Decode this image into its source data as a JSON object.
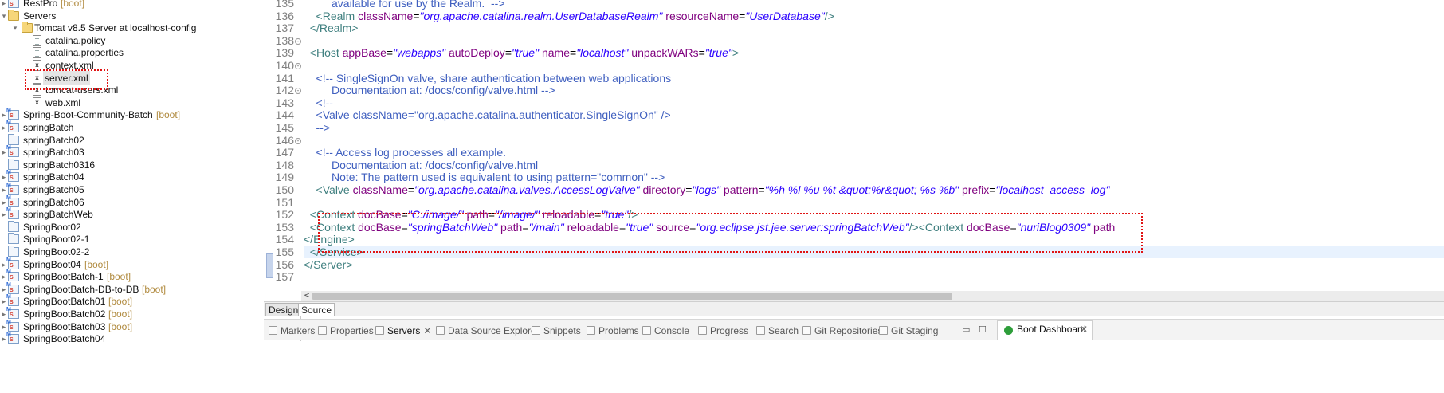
{
  "explorer": {
    "rows": [
      {
        "label": "RestPro",
        "tag": "[boot]",
        "icon": "spring-project-icon",
        "twisty": "▸"
      },
      {
        "label": "Servers",
        "tag": "",
        "icon": "folder-icon",
        "twisty": "▾"
      },
      {
        "label": "Tomcat v8.5 Server at localhost-config",
        "tag": "",
        "icon": "folder-icon",
        "twisty": "▾"
      },
      {
        "label": "catalina.policy",
        "tag": "",
        "icon": "file-icon",
        "twisty": ""
      },
      {
        "label": "catalina.properties",
        "tag": "",
        "icon": "file-icon",
        "twisty": ""
      },
      {
        "label": "context.xml",
        "tag": "",
        "icon": "xml-file-icon",
        "twisty": ""
      },
      {
        "label": "server.xml",
        "tag": "",
        "icon": "xml-file-icon",
        "twisty": ""
      },
      {
        "label": "tomcat-users.xml",
        "tag": "",
        "icon": "xml-file-icon",
        "twisty": ""
      },
      {
        "label": "web.xml",
        "tag": "",
        "icon": "xml-file-icon",
        "twisty": ""
      },
      {
        "label": "Spring-Boot-Community-Batch",
        "tag": "[boot]",
        "icon": "spring-project-icon",
        "twisty": "▸"
      },
      {
        "label": "springBatch",
        "tag": "",
        "icon": "spring-project-icon",
        "twisty": "▸"
      },
      {
        "label": "springBatch02",
        "tag": "",
        "icon": "project-icon",
        "twisty": ""
      },
      {
        "label": "springBatch03",
        "tag": "",
        "icon": "spring-project-icon",
        "twisty": "▸"
      },
      {
        "label": "springBatch0316",
        "tag": "",
        "icon": "project-icon",
        "twisty": ""
      },
      {
        "label": "springBatch04",
        "tag": "",
        "icon": "spring-project-icon",
        "twisty": "▸"
      },
      {
        "label": "springBatch05",
        "tag": "",
        "icon": "spring-project-icon",
        "twisty": "▸"
      },
      {
        "label": "springBatch06",
        "tag": "",
        "icon": "spring-project-icon",
        "twisty": "▸"
      },
      {
        "label": "springBatchWeb",
        "tag": "",
        "icon": "spring-project-icon",
        "twisty": "▸"
      },
      {
        "label": "SpringBoot02",
        "tag": "",
        "icon": "project-icon",
        "twisty": ""
      },
      {
        "label": "SpringBoot02-1",
        "tag": "",
        "icon": "project-icon",
        "twisty": ""
      },
      {
        "label": "SpringBoot02-2",
        "tag": "",
        "icon": "project-icon",
        "twisty": ""
      },
      {
        "label": "SpringBoot04",
        "tag": "[boot]",
        "icon": "spring-project-icon",
        "twisty": "▸"
      },
      {
        "label": "SpringBootBatch-1",
        "tag": "[boot]",
        "icon": "spring-project-icon",
        "twisty": "▸"
      },
      {
        "label": "SpringBootBatch-DB-to-DB",
        "tag": "[boot]",
        "icon": "spring-project-icon",
        "twisty": "▸"
      },
      {
        "label": "SpringBootBatch01",
        "tag": "[boot]",
        "icon": "spring-project-icon",
        "twisty": "▸"
      },
      {
        "label": "SpringBootBatch02",
        "tag": "[boot]",
        "icon": "spring-project-icon",
        "twisty": "▸"
      },
      {
        "label": "SpringBootBatch03",
        "tag": "[boot]",
        "icon": "spring-project-icon",
        "twisty": "▸"
      },
      {
        "label": "SpringBootBatch04",
        "tag": "",
        "icon": "spring-project-icon",
        "twisty": "▸"
      }
    ]
  },
  "editor": {
    "lines": [
      {
        "num": "135",
        "fold": false,
        "tokens": [
          {
            "t": "com",
            "v": "         available for use by the Realm.  -->"
          }
        ]
      },
      {
        "num": "136",
        "fold": false,
        "tokens": [
          {
            "t": "tag",
            "v": "    <Realm "
          },
          {
            "t": "attr",
            "v": "className"
          },
          {
            "t": "plain",
            "v": "="
          },
          {
            "t": "val",
            "v": "\"org.apache.catalina.realm.UserDatabaseRealm\""
          },
          {
            "t": "attr",
            "v": " resourceName"
          },
          {
            "t": "plain",
            "v": "="
          },
          {
            "t": "val",
            "v": "\"UserDatabase\""
          },
          {
            "t": "tag",
            "v": "/>"
          }
        ]
      },
      {
        "num": "137",
        "fold": false,
        "tokens": [
          {
            "t": "tag",
            "v": "  </Realm>"
          }
        ]
      },
      {
        "num": "138",
        "fold": true,
        "tokens": []
      },
      {
        "num": "139",
        "fold": false,
        "tokens": [
          {
            "t": "tag",
            "v": "  <Host "
          },
          {
            "t": "attr",
            "v": "appBase"
          },
          {
            "t": "plain",
            "v": "="
          },
          {
            "t": "val",
            "v": "\"webapps\""
          },
          {
            "t": "attr",
            "v": " autoDeploy"
          },
          {
            "t": "plain",
            "v": "="
          },
          {
            "t": "val",
            "v": "\"true\""
          },
          {
            "t": "attr",
            "v": " name"
          },
          {
            "t": "plain",
            "v": "="
          },
          {
            "t": "val",
            "v": "\"localhost\""
          },
          {
            "t": "attr",
            "v": " unpackWARs"
          },
          {
            "t": "plain",
            "v": "="
          },
          {
            "t": "val",
            "v": "\"true\""
          },
          {
            "t": "tag",
            "v": ">"
          }
        ]
      },
      {
        "num": "140",
        "fold": true,
        "tokens": []
      },
      {
        "num": "141",
        "fold": false,
        "tokens": [
          {
            "t": "com",
            "v": "    <!-- SingleSignOn valve, share authentication between web applications"
          }
        ]
      },
      {
        "num": "142",
        "fold": true,
        "tokens": [
          {
            "t": "com",
            "v": "         Documentation at: /docs/config/valve.html -->"
          }
        ]
      },
      {
        "num": "143",
        "fold": false,
        "tokens": [
          {
            "t": "com",
            "v": "    <!--"
          }
        ]
      },
      {
        "num": "144",
        "fold": false,
        "tokens": [
          {
            "t": "com",
            "v": "    <Valve className=\"org.apache.catalina.authenticator.SingleSignOn\" />"
          }
        ]
      },
      {
        "num": "145",
        "fold": false,
        "tokens": [
          {
            "t": "com",
            "v": "    -->"
          }
        ]
      },
      {
        "num": "146",
        "fold": true,
        "tokens": []
      },
      {
        "num": "147",
        "fold": false,
        "tokens": [
          {
            "t": "com",
            "v": "    <!-- Access log processes all example."
          }
        ]
      },
      {
        "num": "148",
        "fold": false,
        "tokens": [
          {
            "t": "com",
            "v": "         Documentation at: /docs/config/valve.html"
          }
        ]
      },
      {
        "num": "149",
        "fold": false,
        "tokens": [
          {
            "t": "com",
            "v": "         Note: The pattern used is equivalent to using pattern=\"common\" -->"
          }
        ]
      },
      {
        "num": "150",
        "fold": false,
        "tokens": [
          {
            "t": "tag",
            "v": "    <Valve "
          },
          {
            "t": "attr",
            "v": "className"
          },
          {
            "t": "plain",
            "v": "="
          },
          {
            "t": "val",
            "v": "\"org.apache.catalina.valves.AccessLogValve\""
          },
          {
            "t": "attr",
            "v": " directory"
          },
          {
            "t": "plain",
            "v": "="
          },
          {
            "t": "val",
            "v": "\"logs\""
          },
          {
            "t": "attr",
            "v": " pattern"
          },
          {
            "t": "plain",
            "v": "="
          },
          {
            "t": "val",
            "v": "\"%h %l %u %t &quot;%r&quot; %s %b\""
          },
          {
            "t": "attr",
            "v": " prefix"
          },
          {
            "t": "plain",
            "v": "="
          },
          {
            "t": "val",
            "v": "\"localhost_access_log\""
          }
        ]
      },
      {
        "num": "151",
        "fold": false,
        "tokens": []
      },
      {
        "num": "152",
        "fold": false,
        "tokens": [
          {
            "t": "tag",
            "v": "  <Context "
          },
          {
            "t": "attr",
            "v": "docBase"
          },
          {
            "t": "plain",
            "v": "="
          },
          {
            "t": "val",
            "v": "\"C:/image/\""
          },
          {
            "t": "attr",
            "v": " path"
          },
          {
            "t": "plain",
            "v": "="
          },
          {
            "t": "val",
            "v": "\"/image/\""
          },
          {
            "t": "attr",
            "v": " reloadable"
          },
          {
            "t": "plain",
            "v": "="
          },
          {
            "t": "val",
            "v": "\"true\""
          },
          {
            "t": "tag",
            "v": "/>"
          }
        ]
      },
      {
        "num": "153",
        "fold": false,
        "tokens": [
          {
            "t": "tag",
            "v": "  <Context "
          },
          {
            "t": "attr",
            "v": "docBase"
          },
          {
            "t": "plain",
            "v": "="
          },
          {
            "t": "val",
            "v": "\"springBatchWeb\""
          },
          {
            "t": "attr",
            "v": " path"
          },
          {
            "t": "plain",
            "v": "="
          },
          {
            "t": "val",
            "v": "\"/main\""
          },
          {
            "t": "attr",
            "v": " reloadable"
          },
          {
            "t": "plain",
            "v": "="
          },
          {
            "t": "val",
            "v": "\"true\""
          },
          {
            "t": "attr",
            "v": " source"
          },
          {
            "t": "plain",
            "v": "="
          },
          {
            "t": "val",
            "v": "\"org.eclipse.jst.jee.server:springBatchWeb\""
          },
          {
            "t": "tag",
            "v": "/><Context "
          },
          {
            "t": "attr",
            "v": "docBase"
          },
          {
            "t": "plain",
            "v": "="
          },
          {
            "t": "val",
            "v": "\"nuriBlog0309\""
          },
          {
            "t": "attr",
            "v": " path"
          }
        ]
      },
      {
        "num": "154",
        "fold": false,
        "tokens": [
          {
            "t": "tag",
            "v": "</Engine>"
          }
        ]
      },
      {
        "num": "155",
        "fold": false,
        "tokens": [
          {
            "t": "tag",
            "v": "  </Service>"
          }
        ]
      },
      {
        "num": "156",
        "fold": false,
        "tokens": [
          {
            "t": "tag",
            "v": "</Server>"
          }
        ]
      },
      {
        "num": "157",
        "fold": false,
        "tokens": []
      }
    ],
    "scroll_left_glyph": "<"
  },
  "editor_tabs": {
    "design": "Design",
    "source": "Source"
  },
  "views": {
    "tabs": [
      {
        "label": "Markers",
        "icon": "markers-icon",
        "close": ""
      },
      {
        "label": "Properties",
        "icon": "properties-icon",
        "close": ""
      },
      {
        "label": "Servers",
        "icon": "servers-icon",
        "close": "✕"
      },
      {
        "label": "Data Source Explorer",
        "icon": "data-source-icon",
        "close": ""
      },
      {
        "label": "Snippets",
        "icon": "snippets-icon",
        "close": ""
      },
      {
        "label": "Problems",
        "icon": "problems-icon",
        "close": ""
      },
      {
        "label": "Console",
        "icon": "console-icon",
        "close": ""
      },
      {
        "label": "Progress",
        "icon": "progress-icon",
        "close": ""
      },
      {
        "label": "Search",
        "icon": "search-icon",
        "close": ""
      },
      {
        "label": "Git Repositories",
        "icon": "git-repositories-icon",
        "close": ""
      },
      {
        "label": "Git Staging",
        "icon": "git-staging-icon",
        "close": ""
      }
    ],
    "minimize": "▭",
    "maximize": "☐",
    "boot_dashboard": {
      "label": "Boot Dashboard",
      "close": "✕"
    }
  }
}
